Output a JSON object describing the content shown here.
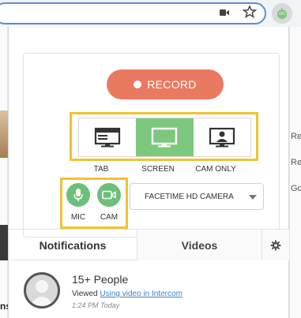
{
  "colors": {
    "record_button": "#e97a61",
    "active_green": "#7dc87f",
    "highlight_outline": "#f1c232",
    "link": "#3b84c4"
  },
  "chrome": {
    "icons": [
      "video-camera-icon",
      "star-icon",
      "extension-icon"
    ]
  },
  "background_page": {
    "right_labels": [
      "Re",
      "Re",
      "Go"
    ],
    "left_label": "ns"
  },
  "recorder": {
    "record_label": "RECORD",
    "modes": [
      {
        "label": "TAB",
        "icon": "tab-window-icon",
        "active": false
      },
      {
        "label": "SCREEN",
        "icon": "monitor-icon",
        "active": true
      },
      {
        "label": "CAM ONLY",
        "icon": "camera-only-icon",
        "active": false
      }
    ],
    "av": [
      {
        "label": "MIC",
        "icon": "microphone-icon",
        "enabled": true
      },
      {
        "label": "CAM",
        "icon": "webcam-icon",
        "enabled": true
      }
    ],
    "camera_select": "FACETIME HD CAMERA"
  },
  "tabs": {
    "notifications": "Notifications",
    "videos": "Videos",
    "settings_icon": "gear-icon"
  },
  "notification": {
    "title": "15+ People",
    "action": "Viewed",
    "link_text": "Using video in Intercom",
    "time": "1:24 PM Today"
  }
}
